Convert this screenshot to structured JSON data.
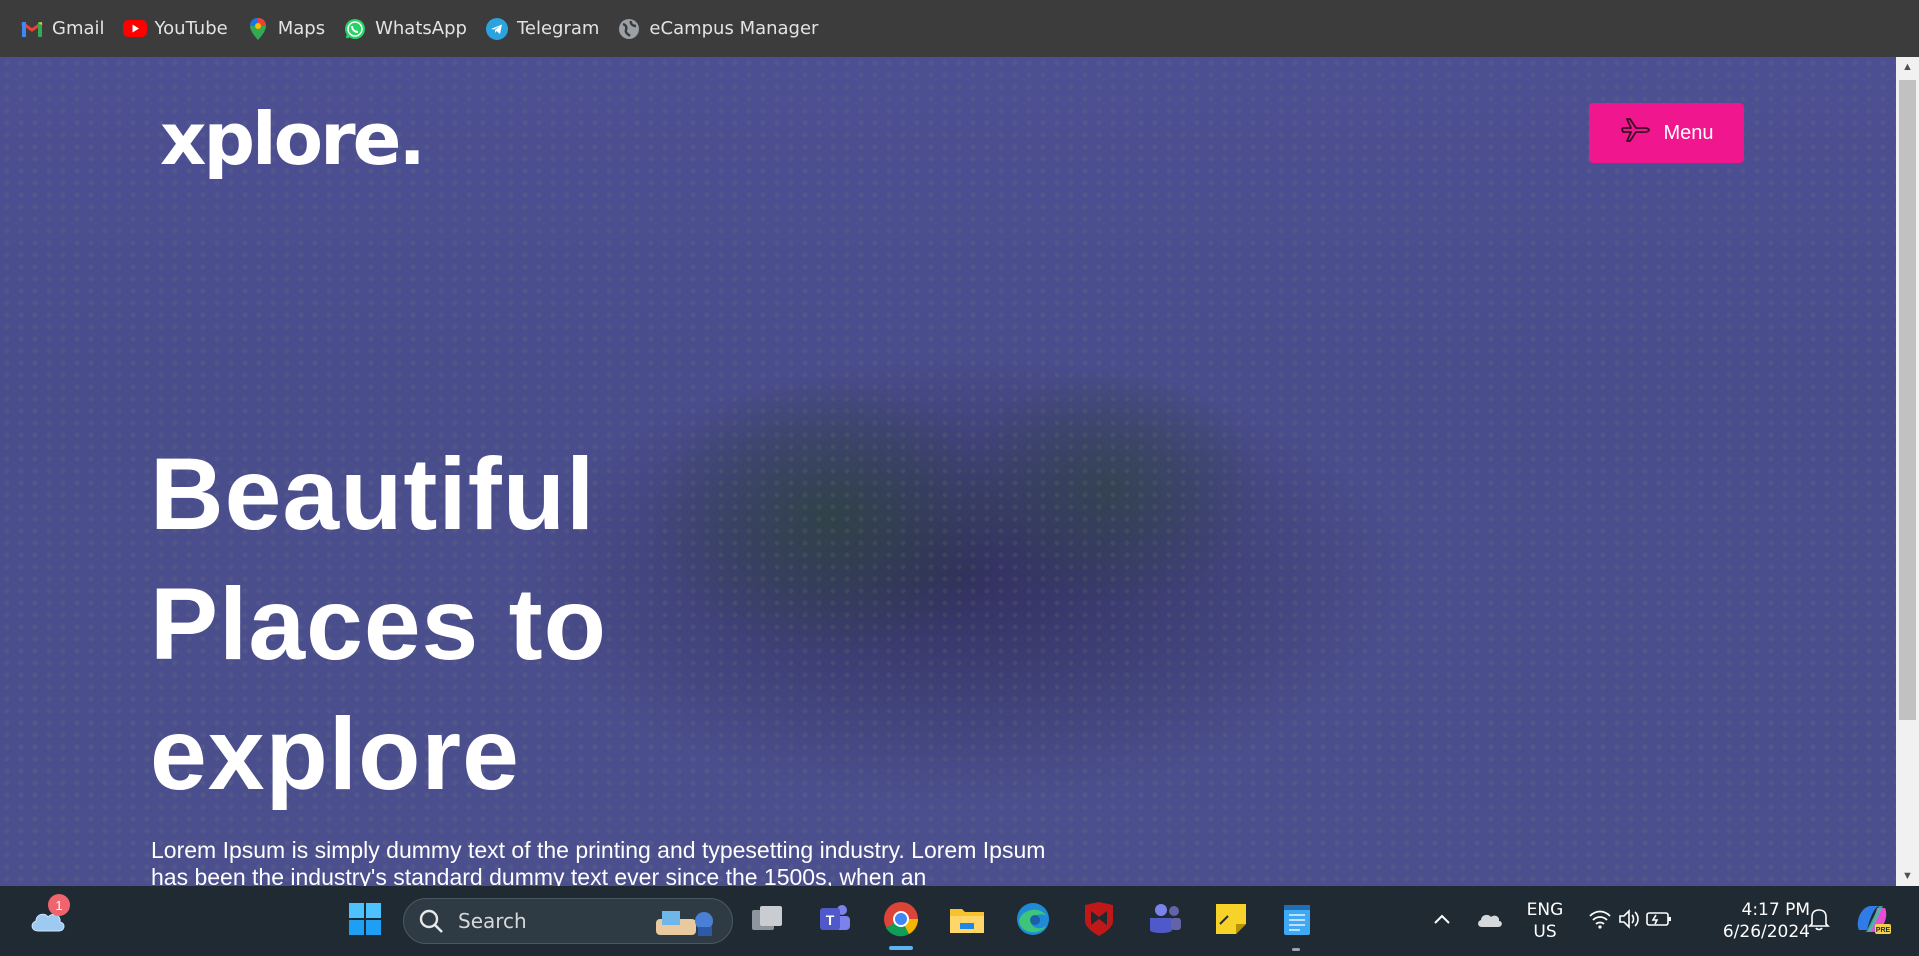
{
  "bookmarks": [
    {
      "label": "Gmail",
      "icon": "gmail-icon"
    },
    {
      "label": "YouTube",
      "icon": "youtube-icon"
    },
    {
      "label": "Maps",
      "icon": "maps-icon"
    },
    {
      "label": "WhatsApp",
      "icon": "whatsapp-icon"
    },
    {
      "label": "Telegram",
      "icon": "telegram-icon"
    },
    {
      "label": "eCampus Manager",
      "icon": "globe-icon"
    }
  ],
  "site": {
    "logo": "xplore.",
    "menu_label": "Menu",
    "hero_title": "Beautiful Places to explore",
    "hero_text": "Lorem Ipsum is simply dummy text of the printing and typesetting industry. Lorem Ipsum has been the industry's standard dummy text ever since the 1500s, when an",
    "accent_color": "#f0168d"
  },
  "taskbar": {
    "weather_badge": "1",
    "search_placeholder": "Search",
    "language_line1": "ENG",
    "language_line2": "US",
    "time": "4:17 PM",
    "date": "6/26/2024",
    "copilot_badge": "PRE"
  }
}
